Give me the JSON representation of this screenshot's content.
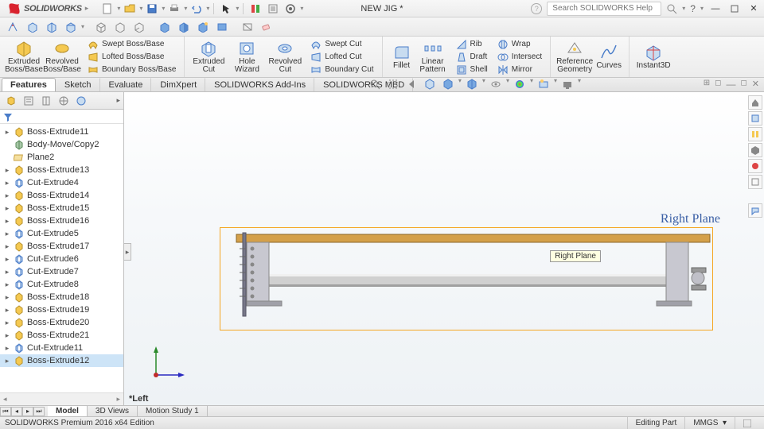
{
  "app": {
    "brand": "SOLIDWORKS",
    "doc_title": "NEW JIG *",
    "search_placeholder": "Search SOLIDWORKS Help"
  },
  "ribbon": {
    "extruded_boss": "Extruded\nBoss/Base",
    "revolved_boss": "Revolved\nBoss/Base",
    "swept_boss": "Swept Boss/Base",
    "lofted_boss": "Lofted Boss/Base",
    "boundary_boss": "Boundary Boss/Base",
    "extruded_cut": "Extruded\nCut",
    "hole_wizard": "Hole\nWizard",
    "revolved_cut": "Revolved\nCut",
    "swept_cut": "Swept Cut",
    "lofted_cut": "Lofted Cut",
    "boundary_cut": "Boundary Cut",
    "fillet": "Fillet",
    "linear_pattern": "Linear\nPattern",
    "rib": "Rib",
    "draft": "Draft",
    "shell": "Shell",
    "wrap": "Wrap",
    "intersect": "Intersect",
    "mirror": "Mirror",
    "ref_geom": "Reference\nGeometry",
    "curves": "Curves",
    "instant3d": "Instant3D"
  },
  "cmd_tabs": [
    "Features",
    "Sketch",
    "Evaluate",
    "DimXpert",
    "SOLIDWORKS Add-Ins",
    "SOLIDWORKS MBD"
  ],
  "tree": [
    {
      "exp": "▸",
      "type": "boss",
      "label": "Boss-Extrude11"
    },
    {
      "exp": "",
      "type": "body",
      "label": "Body-Move/Copy2"
    },
    {
      "exp": "",
      "type": "plane",
      "label": "Plane2"
    },
    {
      "exp": "▸",
      "type": "boss",
      "label": "Boss-Extrude13"
    },
    {
      "exp": "▸",
      "type": "cut",
      "label": "Cut-Extrude4"
    },
    {
      "exp": "▸",
      "type": "boss",
      "label": "Boss-Extrude14"
    },
    {
      "exp": "▸",
      "type": "boss",
      "label": "Boss-Extrude15"
    },
    {
      "exp": "▸",
      "type": "boss",
      "label": "Boss-Extrude16"
    },
    {
      "exp": "▸",
      "type": "cut",
      "label": "Cut-Extrude5"
    },
    {
      "exp": "▸",
      "type": "boss",
      "label": "Boss-Extrude17"
    },
    {
      "exp": "▸",
      "type": "cut",
      "label": "Cut-Extrude6"
    },
    {
      "exp": "▸",
      "type": "cut",
      "label": "Cut-Extrude7"
    },
    {
      "exp": "▸",
      "type": "cut",
      "label": "Cut-Extrude8"
    },
    {
      "exp": "▸",
      "type": "boss",
      "label": "Boss-Extrude18"
    },
    {
      "exp": "▸",
      "type": "boss",
      "label": "Boss-Extrude19"
    },
    {
      "exp": "▸",
      "type": "boss",
      "label": "Boss-Extrude20"
    },
    {
      "exp": "▸",
      "type": "boss",
      "label": "Boss-Extrude21"
    },
    {
      "exp": "▸",
      "type": "cut",
      "label": "Cut-Extrude11"
    },
    {
      "exp": "▸",
      "type": "boss",
      "label": "Boss-Extrude12",
      "sel": true
    }
  ],
  "viewport": {
    "plane_label": "Right Plane",
    "tooltip": "Right Plane",
    "view_label": "*Left",
    "triad": {
      "y": "Y",
      "z": "Z"
    }
  },
  "bottom_tabs": [
    "Model",
    "3D Views",
    "Motion Study 1"
  ],
  "status": {
    "left": "SOLIDWORKS Premium 2016 x64 Edition",
    "mode": "Editing Part",
    "units": "MMGS"
  }
}
